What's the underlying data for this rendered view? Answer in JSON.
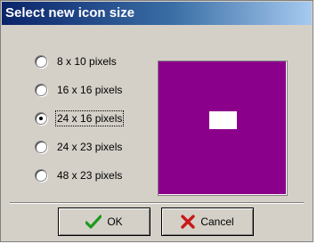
{
  "dialog": {
    "title": "Select new icon size"
  },
  "options": [
    {
      "label": "8 x 10 pixels",
      "checked": false
    },
    {
      "label": "16 x 16 pixels",
      "checked": false
    },
    {
      "label": "24 x 16 pixels",
      "checked": true
    },
    {
      "label": "24 x 23 pixels",
      "checked": false
    },
    {
      "label": "48 x 23 pixels",
      "checked": false
    }
  ],
  "preview": {
    "background_color": "#8b008b",
    "icon_color": "#ffffff"
  },
  "buttons": {
    "ok_label": "OK",
    "ok_icon": "checkmark-icon",
    "cancel_label": "Cancel",
    "cancel_icon": "x-icon"
  }
}
